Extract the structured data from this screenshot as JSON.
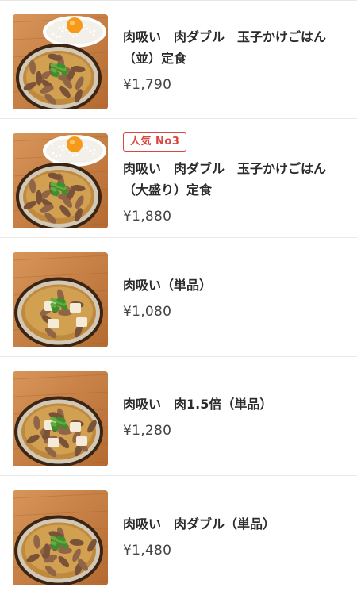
{
  "menu_items": [
    {
      "name": "肉吸い　肉ダブル　玉子かけごはん（並）定食",
      "price": "¥1,790",
      "badge": "",
      "egg": true,
      "bowl": "beef"
    },
    {
      "name": "肉吸い　肉ダブル　玉子かけごはん（大盛り）定食",
      "price": "¥1,880",
      "badge": "人気 No3",
      "egg": true,
      "bowl": "beef"
    },
    {
      "name": "肉吸い（単品）",
      "price": "¥1,080",
      "badge": "",
      "egg": false,
      "bowl": "tofu"
    },
    {
      "name": "肉吸い　肉1.5倍（単品）",
      "price": "¥1,280",
      "badge": "",
      "egg": false,
      "bowl": "beef-tofu"
    },
    {
      "name": "肉吸い　肉ダブル（単品）",
      "price": "¥1,480",
      "badge": "",
      "egg": false,
      "bowl": "beef"
    }
  ]
}
